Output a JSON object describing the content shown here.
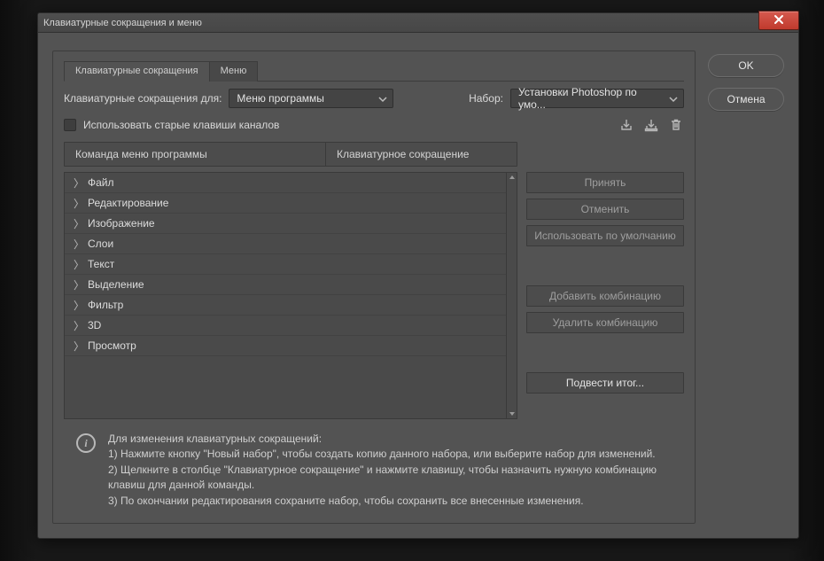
{
  "window": {
    "title": "Клавиатурные сокращения и меню"
  },
  "side": {
    "ok": "OK",
    "cancel": "Отмена"
  },
  "tabs": {
    "shortcuts": "Клавиатурные сокращения",
    "menus": "Меню"
  },
  "controls": {
    "for_label": "Клавиатурные сокращения для:",
    "for_value": "Меню программы",
    "set_label": "Набор:",
    "set_value": "Установки Photoshop по умо...",
    "legacy_checkbox": "Использовать старые клавиши каналов"
  },
  "columns": {
    "command": "Команда меню программы",
    "shortcut": "Клавиатурное сокращение"
  },
  "tree": [
    "Файл",
    "Редактирование",
    "Изображение",
    "Слои",
    "Текст",
    "Выделение",
    "Фильтр",
    "3D",
    "Просмотр"
  ],
  "actions": {
    "accept": "Принять",
    "undo": "Отменить",
    "use_default": "Использовать по умолчанию",
    "add_combo": "Добавить комбинацию",
    "del_combo": "Удалить комбинацию",
    "summarize": "Подвести итог..."
  },
  "info": {
    "l0": "Для изменения клавиатурных сокращений:",
    "l1": "1) Нажмите кнопку \"Новый набор\", чтобы создать копию данного набора, или выберите набор для изменений.",
    "l2": "2) Щелкните в столбце \"Клавиатурное сокращение\" и нажмите клавишу, чтобы назначить нужную комбинацию клавиш для данной команды.",
    "l3": "3) По окончании редактирования сохраните набор, чтобы сохранить все внесенные изменения."
  }
}
